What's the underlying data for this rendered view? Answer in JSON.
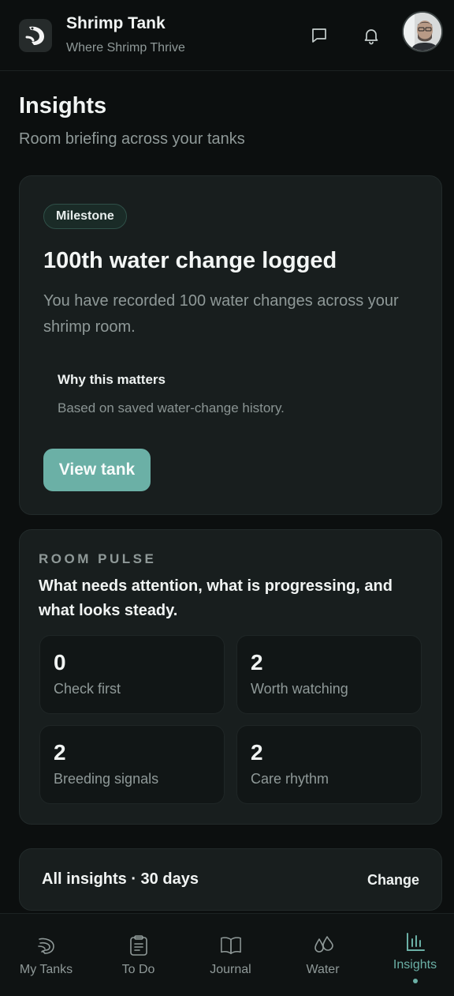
{
  "header": {
    "app_title": "Shrimp Tank",
    "app_subtitle": "Where Shrimp Thrive",
    "icons": [
      "chat-icon",
      "bell-icon"
    ]
  },
  "page": {
    "title": "Insights",
    "subtitle": "Room briefing across your tanks"
  },
  "milestone": {
    "badge": "Milestone",
    "title": "100th water change logged",
    "description": "You have recorded 100 water changes across your shrimp room.",
    "why_title": "Why this matters",
    "why_description": "Based on saved water-change history.",
    "button_label": "View tank"
  },
  "room_pulse": {
    "eyebrow": "ROOM PULSE",
    "headline": "What needs attention, what is progressing, and what looks steady.",
    "stats": [
      {
        "value": "0",
        "label": "Check first"
      },
      {
        "value": "2",
        "label": "Worth watching"
      },
      {
        "value": "2",
        "label": "Breeding signals"
      },
      {
        "value": "2",
        "label": "Care rhythm"
      }
    ]
  },
  "filter": {
    "label": "All insights · 30 days",
    "action": "Change"
  },
  "bottom_nav": {
    "items": [
      {
        "label": "My Tanks",
        "icon": "shrimp-icon"
      },
      {
        "label": "To Do",
        "icon": "clipboard-icon"
      },
      {
        "label": "Journal",
        "icon": "book-icon"
      },
      {
        "label": "Water",
        "icon": "droplets-icon"
      },
      {
        "label": "Insights",
        "icon": "bar-chart-icon",
        "active": true
      }
    ]
  },
  "colors": {
    "background": "#0c0f0f",
    "card": "#181e1e",
    "accent": "#6bb0a6",
    "muted_text": "#8f9998"
  }
}
